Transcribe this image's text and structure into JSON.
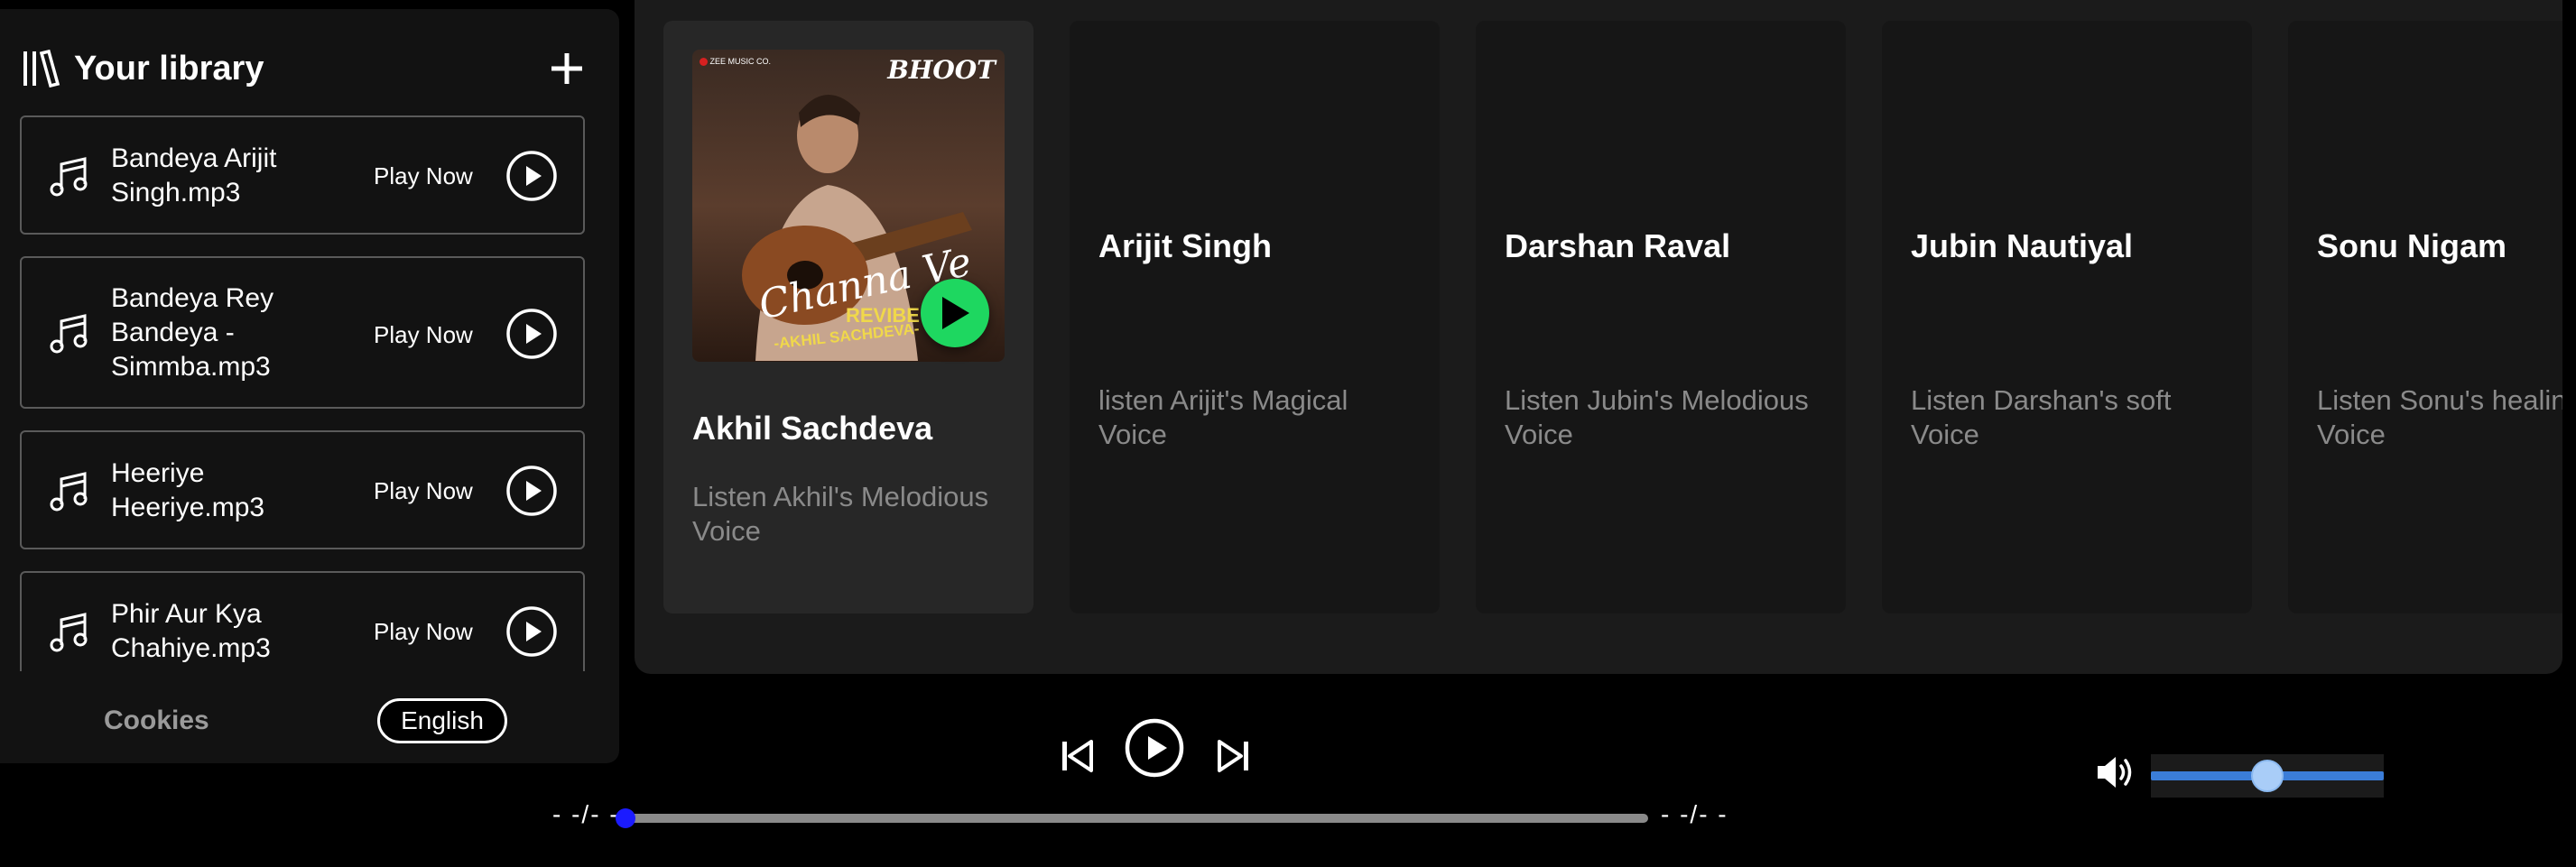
{
  "library": {
    "title": "Your library",
    "tracks": [
      {
        "title": "Bandeya Arijit Singh.mp3",
        "action": "Play Now"
      },
      {
        "title": "Bandeya Rey Bandeya - Simmba.mp3",
        "action": "Play Now"
      },
      {
        "title": "Heeriye Heeriye.mp3",
        "action": "Play Now"
      },
      {
        "title": "Phir Aur Kya Chahiye.mp3",
        "action": "Play Now"
      }
    ],
    "footer": {
      "cookies": "Cookies",
      "language": "English"
    }
  },
  "artists": [
    {
      "name": "Akhil Sachdeva",
      "desc": "Listen Akhil's Melodious Voice",
      "cover": {
        "top_logo": "BHOOT",
        "brand": "ZEE MUSIC CO.",
        "script_title": "Channa Ve",
        "subtitle": "REVIBE",
        "byline": "-AKHIL SACHDEVA-"
      }
    },
    {
      "name": "Arijit Singh",
      "desc": "listen Arijit's Magical Voice"
    },
    {
      "name": "Darshan Raval",
      "desc": "Listen Jubin's Melodious Voice"
    },
    {
      "name": "Jubin Nautiyal",
      "desc": "Listen Darshan's soft Voice"
    },
    {
      "name": "Sonu Nigam",
      "desc": "Listen Sonu's healing Voice"
    }
  ],
  "player": {
    "current_time": "- -/- -",
    "total_time": "- -/- -",
    "progress": 0,
    "volume": 0.5
  },
  "colors": {
    "accent_green": "#1ed760",
    "progress_blue": "#1b1bff",
    "volume_blue": "#3b7dd8"
  }
}
